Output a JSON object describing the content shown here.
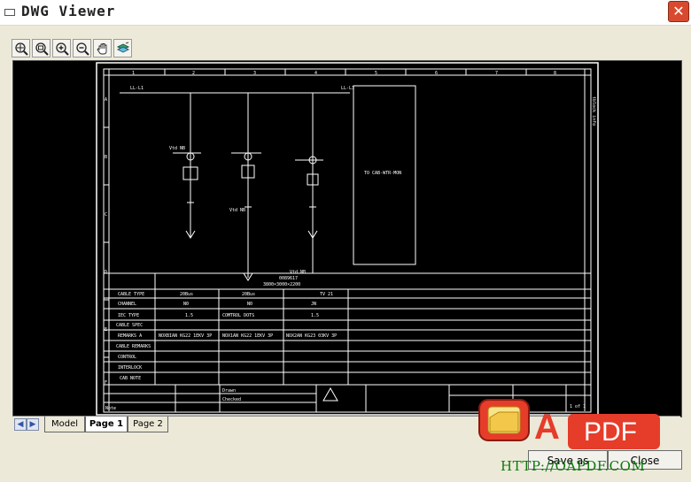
{
  "window": {
    "title": "DWG Viewer",
    "close_symbol": "✕"
  },
  "toolbar": {
    "tools": [
      {
        "name": "zoom-extents"
      },
      {
        "name": "zoom-window"
      },
      {
        "name": "zoom-in"
      },
      {
        "name": "zoom-out"
      },
      {
        "name": "pan"
      },
      {
        "name": "layers"
      }
    ]
  },
  "drawing": {
    "grid_columns": [
      "1",
      "2",
      "3",
      "4",
      "5",
      "6",
      "7",
      "8"
    ],
    "grid_rows": [
      "A",
      "B",
      "C",
      "D",
      "E",
      "F"
    ],
    "right_margin_text": "tblock info",
    "top_labels": {
      "left_bus": "LL-L1",
      "right_bus": "LL-L3",
      "mid_note": "Vtd NB"
    },
    "feeder_labels": [
      "Vtd NB",
      "Vtd NB",
      "Vtd NB"
    ],
    "right_box_label": "TO CAB-WTR-MON",
    "table_rows": [
      "CABLE TYPE",
      "CHANNEL",
      "IEC TYPE",
      "CABLE SPEC",
      "REMARKS A",
      "CABLE REMARKS",
      "CONTROL",
      "INTERLOCK",
      "CAB NOTE"
    ],
    "table_header": [
      "0089617",
      "3800×3000×2200"
    ],
    "table_values": {
      "col1": [
        "20Bus",
        "N0",
        "1.5",
        "NOXBIAN KG22 1EKV 3P"
      ],
      "col2": [
        "20Bus",
        "N0",
        "COMTROL DOTS",
        "NOX1AN KG22 1EKV 3P"
      ],
      "col3": [
        "",
        "",
        "1.5",
        "NOX2AN KG23 03KV 3P"
      ],
      "col4": [
        "TV 21",
        "JN",
        "",
        ""
      ]
    },
    "title_block": {
      "drawn": "Drawn",
      "checked": "Checked",
      "note": "Note",
      "section": "1 of 1"
    }
  },
  "tabs": [
    {
      "label": "Model",
      "active": false
    },
    {
      "label": "Page 1",
      "active": true
    },
    {
      "label": "Page 2",
      "active": false
    }
  ],
  "buttons": {
    "save_as": "Save as",
    "close": "Close"
  },
  "watermark": {
    "url": "HTTP://OAPDF.COM",
    "logo_letter": "A",
    "logo_text": "PDF"
  }
}
